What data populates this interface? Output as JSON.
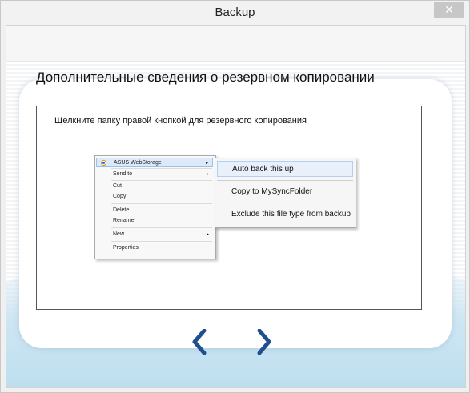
{
  "window": {
    "title": "Backup",
    "close_glyph": "✕"
  },
  "page": {
    "heading": "Дополнительные сведения о резервном копировании",
    "instruction": "Щелкните папку правой кнопкой для резервного копирования"
  },
  "context_menu": {
    "items": [
      {
        "label": "ASUS WebStorage",
        "has_submenu": true,
        "icon": "asus-webstorage-icon"
      },
      {
        "label": "Send to",
        "has_submenu": true
      },
      {
        "label": "Cut"
      },
      {
        "label": "Copy"
      },
      {
        "label": "Delete"
      },
      {
        "label": "Rename"
      },
      {
        "label": "New",
        "has_submenu": true
      },
      {
        "label": "Properties"
      }
    ],
    "submenu_arrow": "▸"
  },
  "submenu": {
    "items": [
      {
        "label": "Auto back this up"
      },
      {
        "label": "Copy to MySyncFolder"
      },
      {
        "label": "Exclude this file type from backup"
      }
    ]
  },
  "navigation": {
    "prev_icon": "chevron-left-icon",
    "next_icon": "chevron-right-icon",
    "color": "#1f4f8f"
  }
}
